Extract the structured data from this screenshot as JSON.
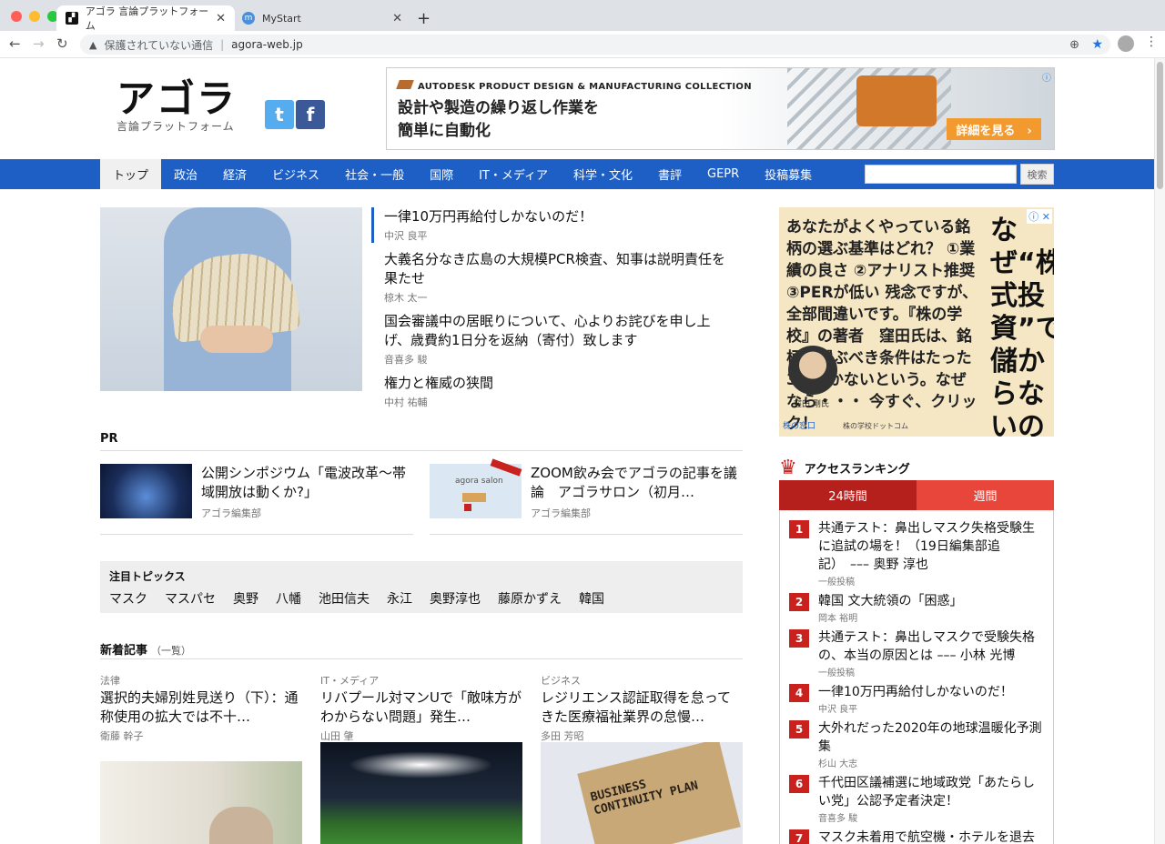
{
  "browser": {
    "tabs": [
      {
        "title": "アゴラ 言論プラットフォーム",
        "icon": "agora-favicon-icon"
      },
      {
        "title": "MyStart",
        "icon": "mystart-favicon-icon"
      }
    ],
    "security": "保護されていない通信",
    "url": "agora-web.jp"
  },
  "header": {
    "logo_main": "アゴラ",
    "logo_sub": "言論プラットフォーム",
    "twitter_label": "t",
    "facebook_label": "f"
  },
  "top_ad": {
    "brand": "AUTODESK PRODUCT DESIGN & MANUFACTURING COLLECTION",
    "line1": "設計や製造の繰り返し作業を",
    "line2": "簡単に自動化",
    "cta": "詳細を見る　›",
    "info": "ⓘ"
  },
  "nav": {
    "items": [
      "トップ",
      "政治",
      "経済",
      "ビジネス",
      "社会・一般",
      "国際",
      "IT・メディア",
      "科学・文化",
      "書評",
      "GEPR",
      "投稿募集"
    ],
    "search_button": "検索"
  },
  "headlines": [
    {
      "title": "一律10万円再給付しかないのだ！",
      "author": "中沢 良平"
    },
    {
      "title": "大義名分なき広島の大規模PCR検査、知事は説明責任を果たせ",
      "author": "椋木 太一"
    },
    {
      "title": "国会審議中の居眠りについて、心よりお詫びを申し上げ、歳費約1日分を返納（寄付）致します",
      "author": "音喜多 駿"
    },
    {
      "title": "権力と権威の狭間",
      "author": "中村 祐輔"
    }
  ],
  "pr": {
    "heading": "PR",
    "items": [
      {
        "title": "公開シンポジウム「電波改革〜帯域開放は動くか?」",
        "author": "アゴラ編集部"
      },
      {
        "title": "ZOOM飲み会でアゴラの記事を議論　アゴラサロン（初月…",
        "author": "アゴラ編集部",
        "thumb_text": "agora salon"
      }
    ]
  },
  "topics": {
    "heading": "注目トピックス",
    "items": [
      "マスク",
      "マスパセ",
      "奥野",
      "八幡",
      "池田信夫",
      "永江",
      "奥野淳也",
      "藤原かずえ",
      "韓国"
    ]
  },
  "new_articles": {
    "heading": "新着記事",
    "sub": "（一覧）",
    "items": [
      {
        "category": "法律",
        "title": "選択的夫婦別姓見送り（下）：通称使用の拡大では不十…",
        "author": "衛藤 幹子"
      },
      {
        "category": "IT・メディア",
        "title": "リバプール対マンUで「敵味方がわからない問題」発生…",
        "author": "山田 肇"
      },
      {
        "category": "ビジネス",
        "title": "レジリエンス認証取得を怠ってきた医療福祉業界の怠慢…",
        "author": "多田 芳昭",
        "img_text": "BUSINESS CONTINUITY PLAN"
      }
    ]
  },
  "side_ad": {
    "headline": "なぜ“株式投資”で儲からないのか？",
    "body": "あなたがよくやっている銘柄の選ぶ基準はどれ？ ①業績の良さ ②アナリスト推奨 ③PERが低い 残念ですが、全部間違いです。『株の学校』の著者　窪田氏は、銘柄を選ぶべき条件はたった3つしかないという。なぜなら・・・ 今すぐ、クリック！",
    "person": "窪田 剛氏",
    "footer1": "株の窓口",
    "footer2": "株の学校ドットコム"
  },
  "ranking": {
    "heading": "アクセスランキング",
    "tabs": [
      "24時間",
      "週間"
    ],
    "items": [
      {
        "rank": "1",
        "title": "共通テスト：鼻出しマスク失格受験生に追試の場を！（19日編集部追記）　––– 奥野 淳也",
        "author": "一般投稿"
      },
      {
        "rank": "2",
        "title": "韓国 文大統領の「困惑」",
        "author": "岡本 裕明"
      },
      {
        "rank": "3",
        "title": "共通テスト：鼻出しマスクで受験失格の、本当の原因とは ––– 小林 光博",
        "author": "一般投稿"
      },
      {
        "rank": "4",
        "title": "一律10万円再給付しかないのだ！",
        "author": "中沢 良平"
      },
      {
        "rank": "5",
        "title": "大外れだった2020年の地球温暖化予測集",
        "author": "杉山 大志"
      },
      {
        "rank": "6",
        "title": "千代田区議補選に地域政党「あたらしい党」公認予定者決定！",
        "author": "音喜多 駿"
      },
      {
        "rank": "7",
        "title": "マスク未着用で航空機・ホテルを退去",
        "author": ""
      }
    ]
  },
  "colors": {
    "nav_blue": "#1e5fc6",
    "rank_red": "#c8211e",
    "rank_tab_active": "#b51f1c",
    "rank_tab_inactive": "#e8463b"
  }
}
